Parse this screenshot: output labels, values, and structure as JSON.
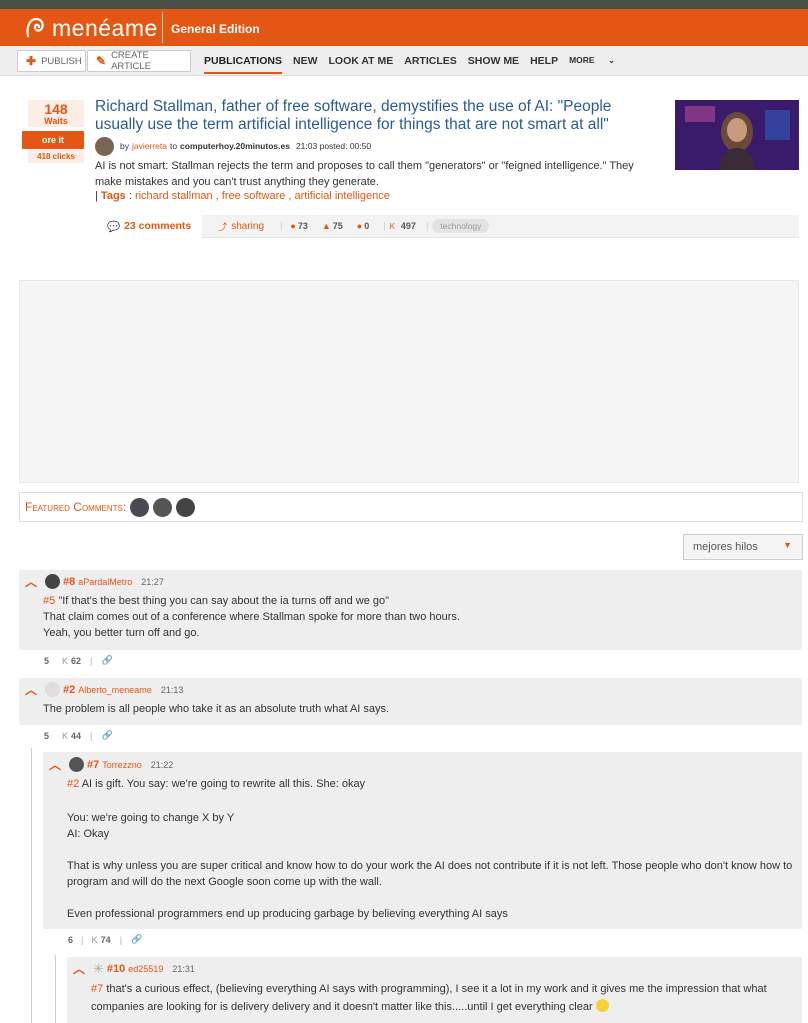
{
  "header": {
    "logo": "menéame",
    "edition": "General Edition"
  },
  "nav": {
    "publish": "PUBLISH",
    "create_article": "CREATE ARTICLE",
    "links": [
      "PUBLICATIONS",
      "NEW",
      "LOOK AT ME",
      "ARTICLES",
      "SHOW ME",
      "HELP"
    ],
    "more": "MORE"
  },
  "story": {
    "votes": "148",
    "votes_label": "Waits",
    "vote_button": "ore it",
    "clicks": "418 clicks",
    "title": "Richard Stallman, father of free software, demystifies the use of AI: \"People usually use the term artificial intelligence for things that are not smart at all\"",
    "by": "by",
    "user": "javierreta",
    "to": "to",
    "domain": "computerhoy.20minutos.es",
    "time": "21:03 posted: 00:50",
    "description": "AI is not smart: Stallman rejects the term and proposes to call them \"generators\" or \"feigned intelligence.\" They make mistakes and you can't trust anything they generate.",
    "tags_label": "Tags",
    "tags": "richard stallman , free software , artificial intelligence",
    "comments_label": "23 comments",
    "share_label": "sharing",
    "stat_a": "73",
    "stat_b": "75",
    "stat_c": "0",
    "karma_k": "K",
    "karma": "497",
    "category": "technology"
  },
  "featured_label": "Featured Comments:",
  "sort": {
    "selected": "mejores hilos"
  },
  "comments": [
    {
      "num": "#8",
      "user": "aPardalMetro",
      "time": "21:27",
      "ref": "#5",
      "lines": [
        "\"If that's the best thing you can say about the ia turns off and we go\"",
        "That claim comes out of a conference where Stallman spoke for more than two hours.",
        "Yeah, you better turn off and go."
      ],
      "votes": "5",
      "karma": "62"
    },
    {
      "num": "#2",
      "user": "Alberto_meneame",
      "time": "21:13",
      "lines": [
        "The problem is all people who take it as an absolute truth what AI says."
      ],
      "votes": "5",
      "karma": "44"
    },
    {
      "num": "#7",
      "user": "Torrezzno",
      "time": "21:22",
      "ref": "#2",
      "lines": [
        "AI is gift. You say: we're going to rewrite all this. She: okay",
        "",
        "You: we're going to change X by Y",
        "AI: Okay",
        "",
        "That is why unless you are super critical and know how to do your work the AI does not contribute if it is not left. Those people who don't know how to program and will do the next Google soon come up with the wall.",
        "",
        "Even professional programmers end up producing garbage by believing everything AI says"
      ],
      "votes": "6",
      "karma": "74"
    },
    {
      "num": "#10",
      "user": "ed25519",
      "time": "21:31",
      "ref": "#7",
      "lines": [
        "that's a curious effect, (believing everything AI says with programming), I see it a lot in my work and it gives me the impression that what companies are looking for is delivery delivery and it doesn't matter like this.....until I get everything clear"
      ]
    }
  ],
  "k_label": "K"
}
